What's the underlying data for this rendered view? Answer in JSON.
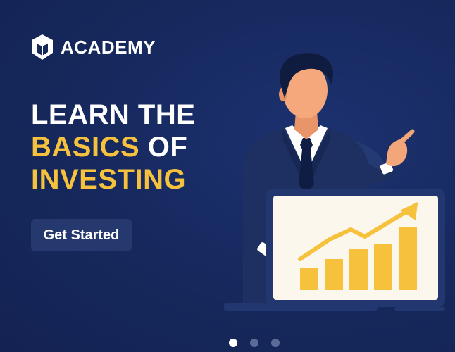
{
  "brand": {
    "name": "ACADEMY",
    "icon": "shield-book-icon"
  },
  "hero": {
    "line1": "LEARN THE",
    "line2_highlight": "BASICS",
    "line2_rest": "OF",
    "line3_highlight": "INVESTING"
  },
  "cta": {
    "label": "Get Started"
  },
  "carousel": {
    "slide_count": 3,
    "active_index": 0
  },
  "colors": {
    "background": "#16275a",
    "accent": "#f6c13c",
    "button": "#25396e",
    "text": "#ffffff"
  },
  "illustration": {
    "subject": "businessman-presenting-chart",
    "icon": "growth-chart-icon"
  }
}
